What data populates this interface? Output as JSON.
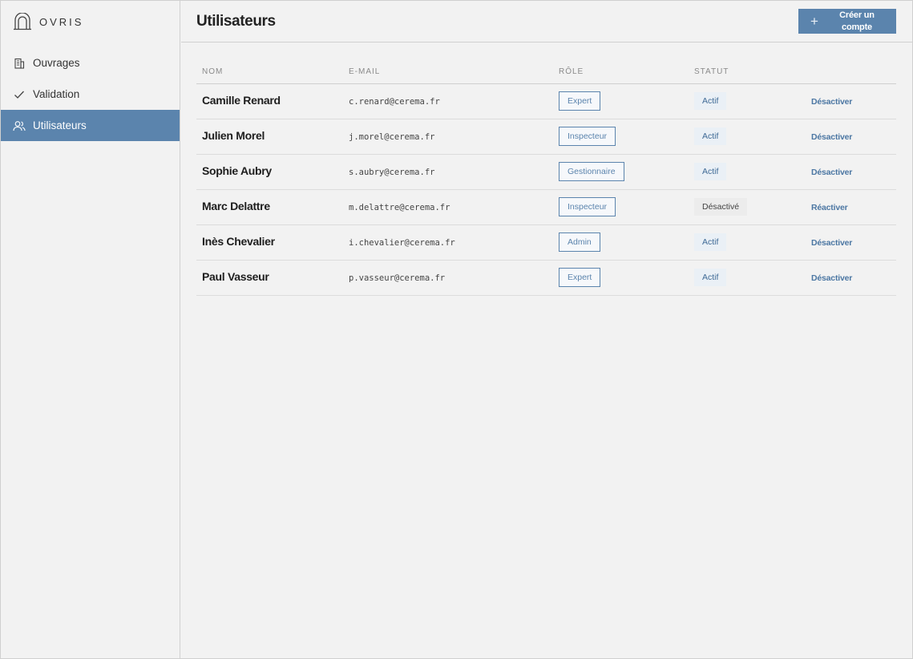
{
  "brand": {
    "name": "OVRIS"
  },
  "sidebar": {
    "items": [
      {
        "label": "Ouvrages",
        "icon": "building-icon",
        "active": false
      },
      {
        "label": "Validation",
        "icon": "check-icon",
        "active": false
      },
      {
        "label": "Utilisateurs",
        "icon": "users-icon",
        "active": true
      }
    ]
  },
  "header": {
    "title": "Utilisateurs",
    "create_button": {
      "icon": "plus-icon",
      "label": "Créer un compte"
    }
  },
  "table": {
    "columns": [
      "NOM",
      "E-MAIL",
      "RÔLE",
      "STATUT",
      ""
    ],
    "rows": [
      {
        "name": "Camille Renard",
        "email": "c.renard@cerema.fr",
        "role": "Expert",
        "status": "Actif",
        "action": "Désactiver"
      },
      {
        "name": "Julien Morel",
        "email": "j.morel@cerema.fr",
        "role": "Inspecteur",
        "status": "Actif",
        "action": "Désactiver"
      },
      {
        "name": "Sophie Aubry",
        "email": "s.aubry@cerema.fr",
        "role": "Gestionnaire",
        "status": "Actif",
        "action": "Désactiver"
      },
      {
        "name": "Marc Delattre",
        "email": "m.delattre@cerema.fr",
        "role": "Inspecteur",
        "status": "Désactivé",
        "action": "Réactiver"
      },
      {
        "name": "Inès Chevalier",
        "email": "i.chevalier@cerema.fr",
        "role": "Admin",
        "status": "Actif",
        "action": "Désactiver"
      },
      {
        "name": "Paul Vasseur",
        "email": "p.vasseur@cerema.fr",
        "role": "Expert",
        "status": "Actif",
        "action": "Désactiver"
      }
    ]
  },
  "colors": {
    "accent": "#5b84ad",
    "background": "#f2f2f2"
  }
}
